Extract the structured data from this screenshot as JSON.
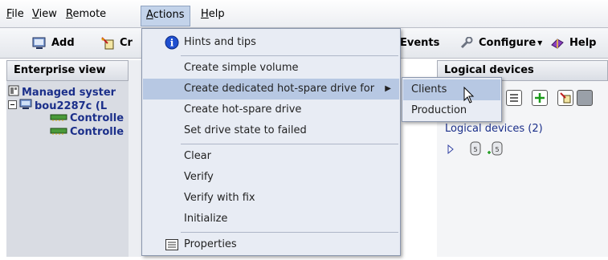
{
  "menubar": [
    {
      "label": "File",
      "accel": "F",
      "rest": "ile"
    },
    {
      "label": "View",
      "accel": "V",
      "rest": "iew"
    },
    {
      "label": "Remote",
      "accel": "R",
      "rest": "emote"
    },
    {
      "label": "Actions",
      "accel": "A",
      "rest": "ctions"
    },
    {
      "label": "Help",
      "accel": "H",
      "rest": "elp"
    }
  ],
  "toolbar": {
    "add_label": "Add",
    "create_partial": "Cr",
    "events_partial": "Events",
    "configure_label": "Configure",
    "help_label": "Help"
  },
  "left_pane": {
    "header": "Enterprise view",
    "root_label": "Managed syster",
    "host_label": "bou2287c (L",
    "controller_1": "Controlle",
    "controller_2": "Controlle"
  },
  "right_pane": {
    "header": "Logical devices",
    "group_label": "Logical devices (2)"
  },
  "actions_menu": {
    "items": [
      {
        "label": "Hints and tips",
        "icon": "info-icon"
      },
      {
        "label": "Create simple volume"
      },
      {
        "label": "Create dedicated hot-spare drive for",
        "submenu": true
      },
      {
        "label": "Create hot-spare drive"
      },
      {
        "label": "Set drive state to failed"
      },
      {
        "label": "Clear"
      },
      {
        "label": "Verify"
      },
      {
        "label": "Verify with fix"
      },
      {
        "label": "Initialize"
      },
      {
        "label": "Properties",
        "icon": "properties-icon"
      }
    ]
  },
  "submenu": {
    "items": [
      {
        "label": "Clients"
      },
      {
        "label": "Production"
      }
    ]
  },
  "colors": {
    "menu_bg": "#e8ecf4",
    "highlight": "#b7c8e3",
    "pane_bg": "#d9dce3",
    "tree_text": "#1b2f8a"
  }
}
